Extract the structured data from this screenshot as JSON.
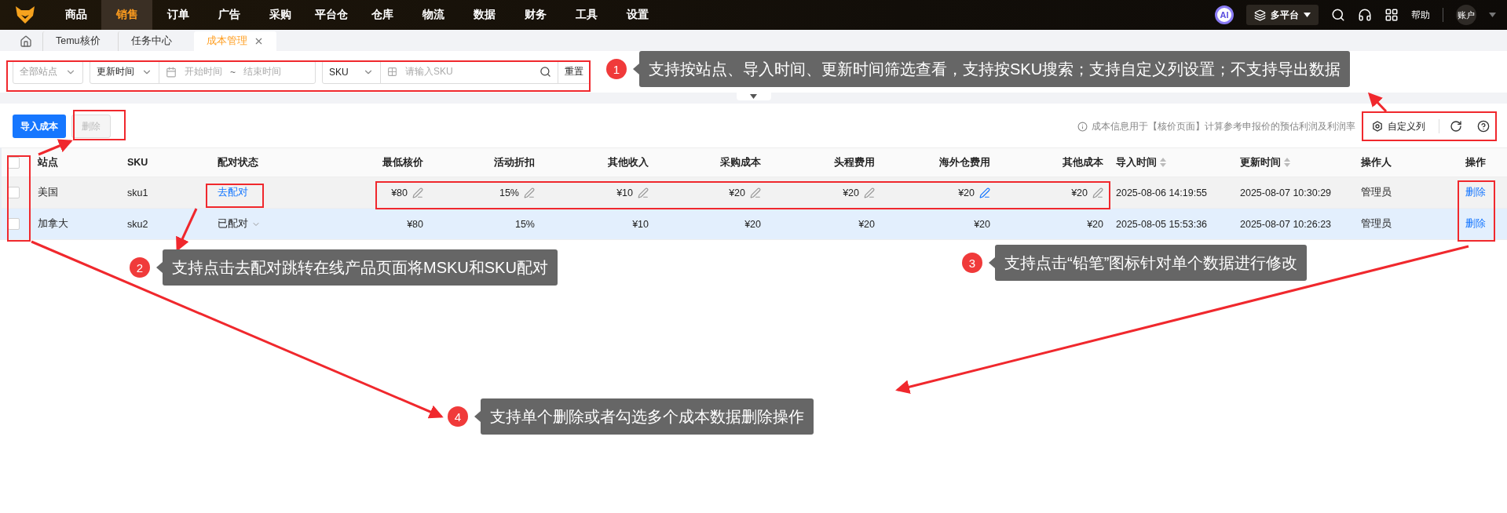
{
  "nav": {
    "items": [
      {
        "label": "商品",
        "selected": false
      },
      {
        "label": "销售",
        "selected": true
      },
      {
        "label": "订单",
        "selected": false
      },
      {
        "label": "广告",
        "selected": false
      },
      {
        "label": "采购",
        "selected": false
      },
      {
        "label": "平台仓",
        "selected": false
      },
      {
        "label": "仓库",
        "selected": false
      },
      {
        "label": "物流",
        "selected": false
      },
      {
        "label": "数据",
        "selected": false
      },
      {
        "label": "财务",
        "selected": false
      },
      {
        "label": "工具",
        "selected": false
      },
      {
        "label": "设置",
        "selected": false
      }
    ],
    "ai_badge": "AI",
    "platform": "多平台",
    "help": "帮助",
    "account": "账户"
  },
  "tabs": [
    {
      "label": "Temu核价",
      "selected": false,
      "closable": false
    },
    {
      "label": "任务中心",
      "selected": false,
      "closable": false
    },
    {
      "label": "成本管理",
      "selected": true,
      "closable": true
    }
  ],
  "filters": {
    "site": "全部站点",
    "time_type": "更新时间",
    "start_placeholder": "开始时间",
    "range_separator": "~",
    "end_placeholder": "结束时间",
    "search_type": "SKU",
    "search_placeholder": "请输入SKU",
    "reset": "重置"
  },
  "toolbar": {
    "import": "导入成本",
    "delete": {
      "label": "删除",
      "disabled": true
    },
    "info": "成本信息用于【核价页面】计算参考申报价的预估利润及利润率",
    "custom_columns": "自定义列"
  },
  "table": {
    "header_checked": false,
    "columns": [
      {
        "label": "站点",
        "sortable": false
      },
      {
        "label": "SKU",
        "sortable": false
      },
      {
        "label": "配对状态",
        "sortable": false
      },
      {
        "label": "最低核价",
        "sortable": false
      },
      {
        "label": "活动折扣",
        "sortable": false
      },
      {
        "label": "其他收入",
        "sortable": false
      },
      {
        "label": "采购成本",
        "sortable": false
      },
      {
        "label": "头程费用",
        "sortable": false
      },
      {
        "label": "海外仓费用",
        "sortable": false
      },
      {
        "label": "其他成本",
        "sortable": false
      },
      {
        "label": "导入时间",
        "sortable": true
      },
      {
        "label": "更新时间",
        "sortable": true
      },
      {
        "label": "操作人",
        "sortable": false
      },
      {
        "label": "操作",
        "sortable": false
      }
    ],
    "rows": [
      {
        "checked": false,
        "hovered": false,
        "site": "美国",
        "sku": "sku1",
        "pair": {
          "kind": "link",
          "label": "去配对"
        },
        "costs": [
          {
            "text": "¥80",
            "editable": true,
            "highlighted": false
          },
          {
            "text": "15%",
            "editable": true,
            "highlighted": false
          },
          {
            "text": "¥10",
            "editable": true,
            "highlighted": false
          },
          {
            "text": "¥20",
            "editable": true,
            "highlighted": false
          },
          {
            "text": "¥20",
            "editable": true,
            "highlighted": false
          },
          {
            "text": "¥20",
            "editable": true,
            "highlighted": true
          },
          {
            "text": "¥20",
            "editable": true,
            "highlighted": false
          }
        ],
        "imported": "2025-08-06 14:19:55",
        "updated": "2025-08-07 10:30:29",
        "operator": "管理员",
        "action": "删除"
      },
      {
        "checked": false,
        "hovered": true,
        "site": "加拿大",
        "sku": "sku2",
        "pair": {
          "kind": "status",
          "label": "已配对"
        },
        "costs": [
          {
            "text": "¥80",
            "editable": false
          },
          {
            "text": "15%",
            "editable": false
          },
          {
            "text": "¥10",
            "editable": false
          },
          {
            "text": "¥20",
            "editable": false
          },
          {
            "text": "¥20",
            "editable": false
          },
          {
            "text": "¥20",
            "editable": false
          },
          {
            "text": "¥20",
            "editable": false
          }
        ],
        "imported": "2025-08-05 15:53:36",
        "updated": "2025-08-07 10:26:23",
        "operator": "管理员",
        "action": "删除"
      }
    ]
  },
  "annotations": [
    {
      "number": "1",
      "text": "支持按站点、导入时间、更新时间筛选查看，支持按SKU搜索；支持自定义列设置；不支持导出数据"
    },
    {
      "number": "2",
      "text": "支持点击去配对跳转在线产品页面将MSKU和SKU配对"
    },
    {
      "number": "3",
      "text": "支持点击“铅笔”图标针对单个数据进行修改"
    },
    {
      "number": "4",
      "text": "支持单个删除或者勾选多个成本数据删除操作"
    }
  ]
}
